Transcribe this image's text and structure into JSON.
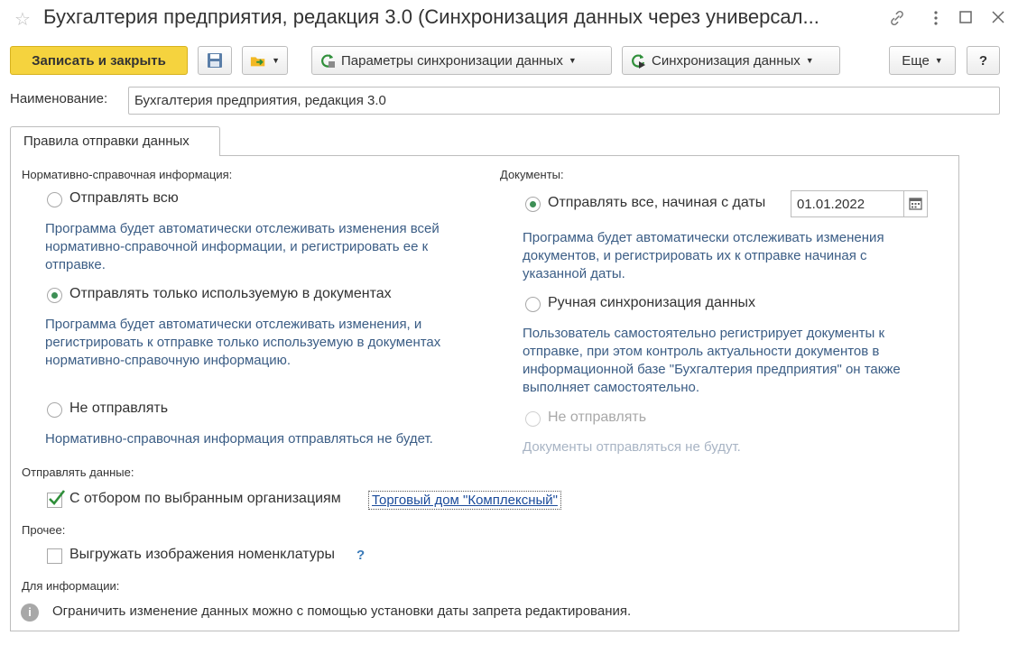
{
  "window": {
    "title": "Бухгалтерия предприятия, редакция 3.0 (Синхронизация данных через универсал...",
    "star_icon": "star-icon",
    "link_icon": "link-icon",
    "maximize_icon": "maximize-icon",
    "close_icon": "close-icon"
  },
  "toolbar": {
    "save_close_label": "Записать и закрыть",
    "params_label": "Параметры синхронизации данных",
    "sync_label": "Синхронизация данных",
    "more_label": "Еще",
    "help_label": "?"
  },
  "name": {
    "label": "Наименование:",
    "value": "Бухгалтерия предприятия, редакция 3.0"
  },
  "tab": {
    "label": "Правила отправки данных"
  },
  "nsi": {
    "title": "Нормативно-справочная информация:",
    "options": [
      {
        "label": "Отправлять всю",
        "selected": false,
        "desc": [
          "Программа будет автоматически отслеживать изменения всей",
          "нормативно-справочной информации, и регистрировать ее к",
          "отправке."
        ]
      },
      {
        "label": "Отправлять только используемую в документах",
        "selected": true,
        "desc": [
          "Программа будет автоматически отслеживать изменения, и",
          "регистрировать к отправке только используемую в документах",
          "нормативно-справочную информацию."
        ]
      },
      {
        "label": "Не отправлять",
        "selected": false,
        "desc": [
          "Нормативно-справочная информация отправляться не будет."
        ]
      }
    ]
  },
  "docs": {
    "title": "Документы:",
    "date_value": "01.01.2022",
    "options": [
      {
        "label": "Отправлять все, начиная с даты",
        "selected": true,
        "desc": [
          "Программа будет автоматически отслеживать изменения",
          "документов, и регистрировать их к отправке начиная с",
          "указанной даты."
        ]
      },
      {
        "label": "Ручная синхронизация данных",
        "selected": false,
        "desc": [
          "Пользователь самостоятельно регистрирует документы к",
          "отправке, при этом контроль актуальности документов в",
          "информационной базе \"Бухгалтерия предприятия\" он также",
          "выполняет самостоятельно."
        ]
      },
      {
        "label": "Не отправлять",
        "selected": false,
        "disabled": true,
        "desc": [
          "Документы отправляться не будут."
        ]
      }
    ]
  },
  "send": {
    "title": "Отправлять данные:",
    "filter_label": "С отбором по выбранным организациям",
    "filter_checked": true,
    "org_link": "Торговый дом \"Комплексный\""
  },
  "other": {
    "title": "Прочее:",
    "images_label": "Выгружать изображения номенклатуры",
    "images_checked": false,
    "help": "?"
  },
  "info": {
    "title": "Для информации:",
    "text": "Ограничить изменение данных можно с помощью установки даты запрета редактирования.",
    "icon": "info-icon"
  },
  "colors": {
    "accent_yellow": "#f5d33e",
    "radio_green": "#3d8f55",
    "desc_blue": "#3b5d85",
    "link_blue": "#1a4b9b"
  }
}
